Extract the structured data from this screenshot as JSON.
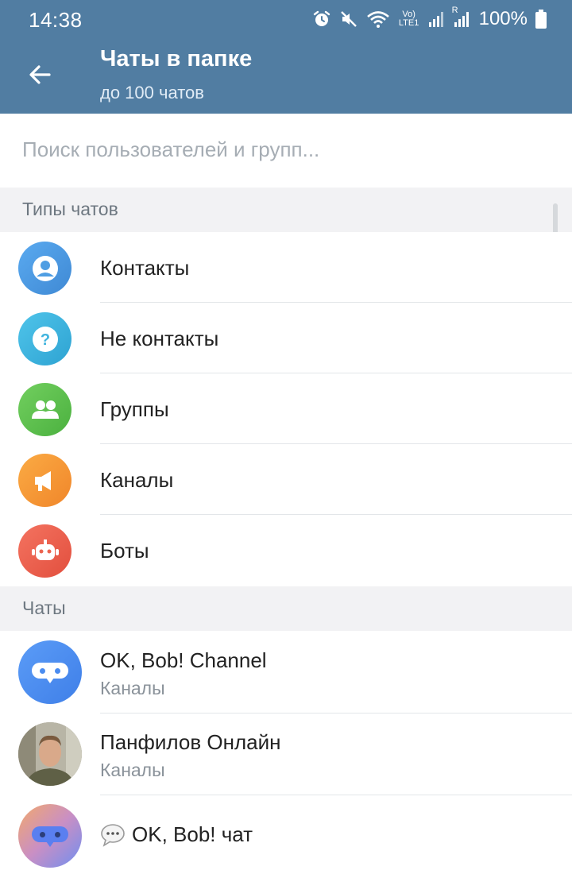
{
  "status": {
    "time": "14:38",
    "battery": "100%",
    "lte": "Vo) LTE1",
    "sim": "R"
  },
  "appbar": {
    "title": "Чаты в папке",
    "subtitle": "до 100 чатов"
  },
  "search": {
    "placeholder": "Поиск пользователей и групп..."
  },
  "sections": {
    "types_header": "Типы чатов",
    "chats_header": "Чаты"
  },
  "chat_types": [
    {
      "label": "Контакты",
      "icon": "contact-icon",
      "color": "#4f9ee3"
    },
    {
      "label": "Не контакты",
      "icon": "question-icon",
      "color": "#3fb4de"
    },
    {
      "label": "Группы",
      "icon": "group-icon",
      "color": "#5fc14f"
    },
    {
      "label": "Каналы",
      "icon": "megaphone-icon",
      "color": "#f59a35"
    },
    {
      "label": "Боты",
      "icon": "bot-icon",
      "color": "#ec6450"
    }
  ],
  "chats": [
    {
      "name": "OK, Bob! Channel",
      "subtitle": "Каналы",
      "icon": "bot-logo-icon"
    },
    {
      "name": "Панфилов Онлайн",
      "subtitle": "Каналы",
      "icon": "person-photo"
    },
    {
      "name": "OK, Bob! чат",
      "subtitle": "",
      "icon": "bot-logo-icon",
      "prefix_icon": "speech-bubble-icon"
    }
  ],
  "colors": {
    "header": "#517da2",
    "section_bg": "#f2f2f4"
  }
}
